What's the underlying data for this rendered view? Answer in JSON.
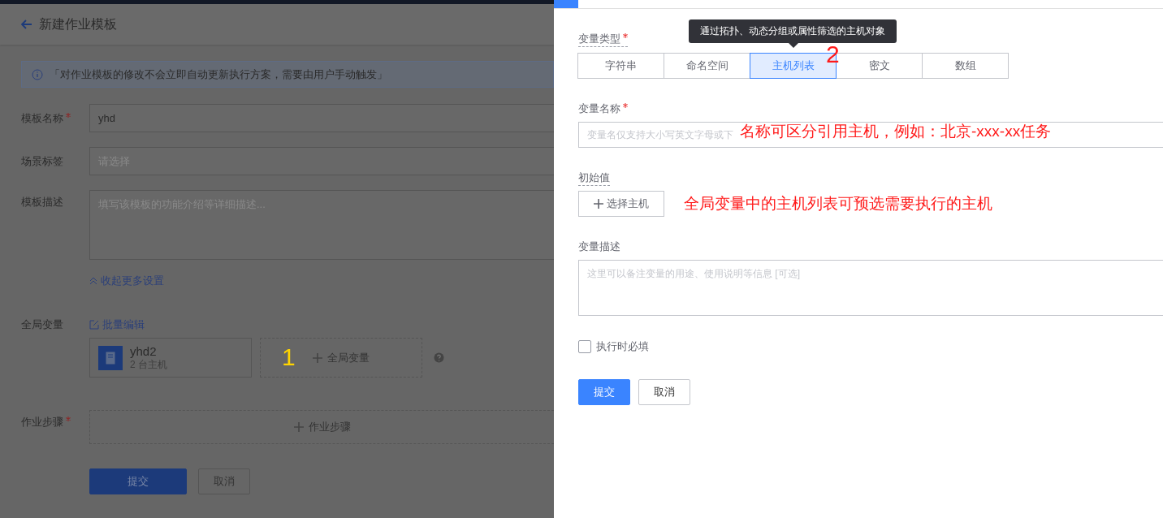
{
  "page": {
    "title": "新建作业模板",
    "notice": "「对作业模板的修改不会立即自动更新执行方案，需要由用户手动触发」",
    "fields": [
      {
        "label": "模板名称",
        "required": true,
        "kind": "input",
        "value": "yhd"
      },
      {
        "label": "场景标签",
        "required": false,
        "kind": "select",
        "placeholder": "请选择"
      },
      {
        "label": "模板描述",
        "required": false,
        "kind": "textarea",
        "placeholder": "填写该模板的功能介绍等详细描述..."
      }
    ],
    "collapse_link": "收起更多设置",
    "global_vars": {
      "label": "全局变量",
      "batch_edit": "批量编辑",
      "variables": [
        {
          "name": "yhd2",
          "detail": "2 台主机"
        }
      ],
      "add_label": "全局变量",
      "annotation": "1"
    },
    "steps": {
      "label": "作业步骤",
      "required": true,
      "add_label": "作业步骤"
    },
    "buttons": [
      "提交",
      "取消"
    ]
  },
  "drawer": {
    "type_label": "变量类型",
    "type_required": true,
    "tooltip": "通过拓扑、动态分组或属性筛选的主机对象",
    "type_annotation": "2",
    "types": [
      {
        "label": "字符串",
        "selected": false
      },
      {
        "label": "命名空间",
        "selected": false
      },
      {
        "label": "主机列表",
        "selected": true
      },
      {
        "label": "密文",
        "selected": false
      },
      {
        "label": "数组",
        "selected": false
      }
    ],
    "name_label": "变量名称",
    "name_required": true,
    "name_placeholder": "变量名仅支持大小写英文字母或下",
    "name_annotation": "名称可区分引用主机，例如：北京-xxx-xx任务",
    "initial_label": "初始值",
    "select_hosts": "选择主机",
    "hosts_annotation": "全局变量中的主机列表可预选需要执行的主机",
    "desc_label": "变量描述",
    "desc_placeholder": "这里可以备注变量的用途、使用说明等信息 [可选]",
    "required_checkbox": {
      "label": "执行时必填",
      "checked": false
    },
    "buttons": [
      "提交",
      "取消"
    ]
  }
}
